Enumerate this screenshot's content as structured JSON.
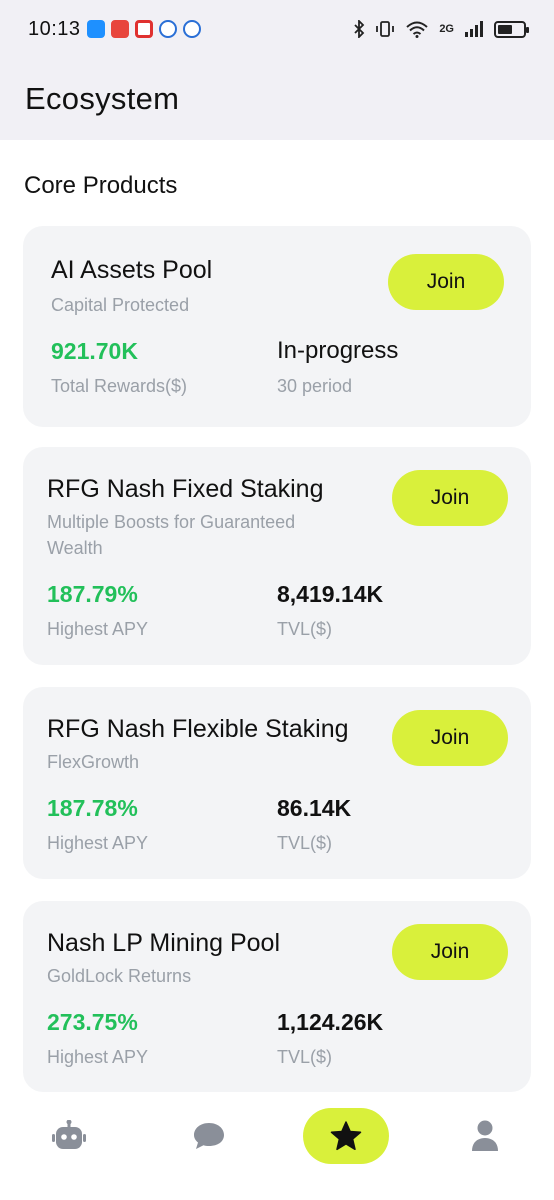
{
  "status": {
    "time": "10:13",
    "network": "2G"
  },
  "header": {
    "title": "Ecosystem"
  },
  "section": {
    "title": "Core Products"
  },
  "cards": [
    {
      "title": "AI Assets Pool",
      "subtitle": "Capital Protected",
      "join_label": "Join",
      "stat1_value": "921.70K",
      "stat1_label": "Total Rewards($)",
      "stat2_value": "In-progress",
      "stat2_label": "30 period"
    },
    {
      "title": "RFG Nash Fixed Staking",
      "subtitle": "Multiple Boosts for Guaranteed Wealth",
      "join_label": "Join",
      "stat1_value": "187.79%",
      "stat1_label": "Highest APY",
      "stat2_value": "8,419.14K",
      "stat2_label": "TVL($)"
    },
    {
      "title": "RFG Nash Flexible Staking",
      "subtitle": "FlexGrowth",
      "join_label": "Join",
      "stat1_value": "187.78%",
      "stat1_label": "Highest APY",
      "stat2_value": "86.14K",
      "stat2_label": "TVL($)"
    },
    {
      "title": "Nash LP Mining Pool",
      "subtitle": "GoldLock Returns",
      "join_label": "Join",
      "stat1_value": "273.75%",
      "stat1_label": "Highest APY",
      "stat2_value": "1,124.26K",
      "stat2_label": "TVL($)"
    }
  ],
  "tabs": [
    {
      "icon": "robot-icon",
      "active": false
    },
    {
      "icon": "chat-bubble-icon",
      "active": false
    },
    {
      "icon": "star-icon",
      "active": true
    },
    {
      "icon": "user-icon",
      "active": false
    }
  ],
  "colors": {
    "accent": "#d9f03b",
    "positive": "#22c05a",
    "card_bg": "#f3f4f6",
    "header_bg": "#f1f0f5",
    "muted_text": "#9aa0a8"
  }
}
